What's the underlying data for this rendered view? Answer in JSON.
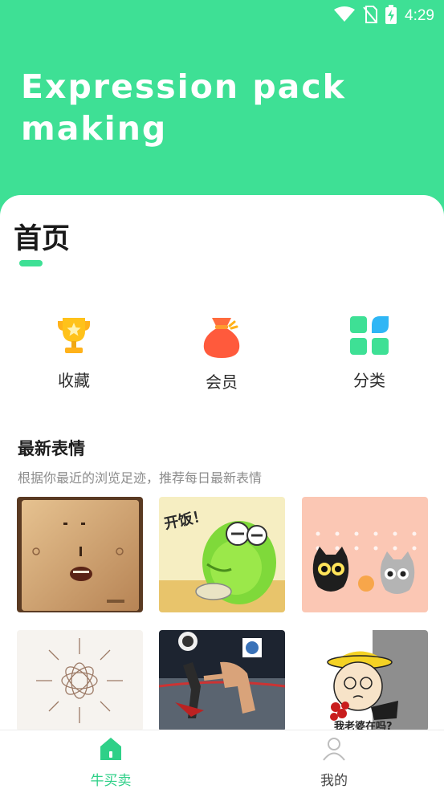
{
  "status_bar": {
    "time": "4:29"
  },
  "hero": {
    "title": "Expression pack making"
  },
  "main": {
    "page_title": "首页",
    "features": [
      {
        "label": "收藏",
        "icon": "trophy-icon"
      },
      {
        "label": "会员",
        "icon": "money-bag-icon"
      },
      {
        "label": "分类",
        "icon": "category-grid-icon"
      }
    ],
    "section_title": "最新表情",
    "section_subtitle": "根据你最近的浏览足迹，推荐每日最新表情"
  },
  "tabbar": {
    "items": [
      {
        "label": "牛买卖",
        "icon": "home-icon",
        "active": true
      },
      {
        "label": "我的",
        "icon": "user-icon",
        "active": false
      }
    ]
  },
  "colors": {
    "accent": "#3ee095",
    "vip": "#ff5a3c",
    "trophy": "#ffc21a"
  }
}
